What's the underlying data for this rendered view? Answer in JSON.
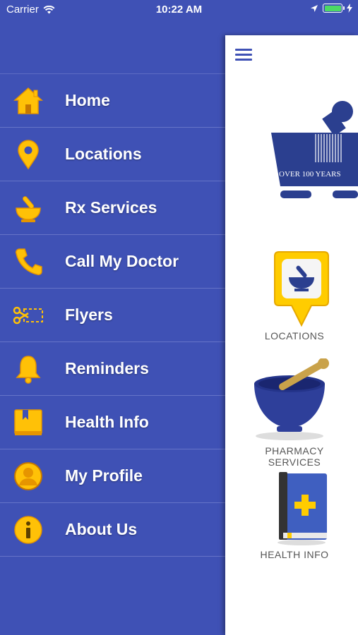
{
  "statusbar": {
    "carrier": "Carrier",
    "time": "10:22 AM"
  },
  "colors": {
    "primary": "#3f51b5",
    "accent": "#ffcc00"
  },
  "drawer": {
    "items": [
      {
        "label": "Home",
        "icon": "home-icon"
      },
      {
        "label": "Locations",
        "icon": "map-pin-icon"
      },
      {
        "label": "Rx Services",
        "icon": "mortar-pestle-icon"
      },
      {
        "label": "Call My Doctor",
        "icon": "phone-icon"
      },
      {
        "label": "Flyers",
        "icon": "coupon-scissors-icon"
      },
      {
        "label": "Reminders",
        "icon": "bell-icon"
      },
      {
        "label": "Health Info",
        "icon": "book-icon"
      },
      {
        "label": "My Profile",
        "icon": "profile-icon"
      },
      {
        "label": "About Us",
        "icon": "info-icon"
      }
    ]
  },
  "main": {
    "logo_text": "OVER 100 YEARS",
    "tiles": [
      {
        "label": "LOCATIONS"
      },
      {
        "label": "PHARMACY SERVICES"
      },
      {
        "label": "HEALTH INFO"
      }
    ]
  }
}
